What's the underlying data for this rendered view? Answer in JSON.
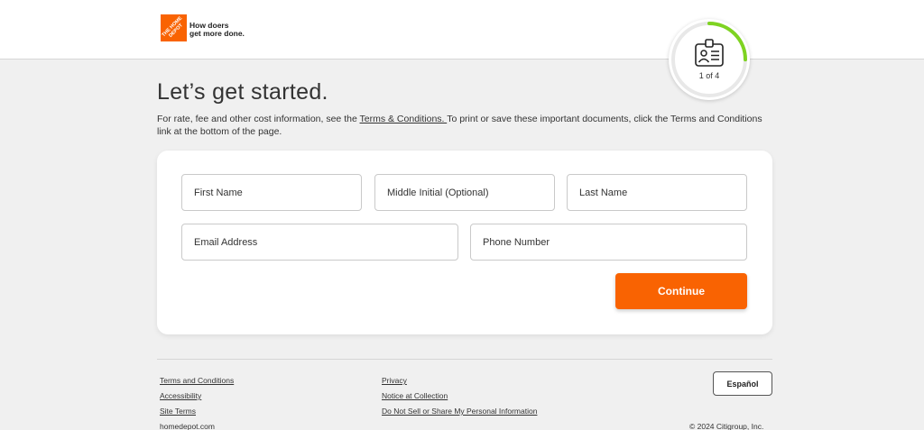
{
  "header": {
    "logo_text": "THE HOME DEPOT",
    "tagline_line1": "How doers",
    "tagline_line2": "get more done."
  },
  "progress": {
    "step_text": "1 of 4",
    "fraction": 0.25,
    "accent_color": "#7ed321"
  },
  "main": {
    "title": "Let’s get started.",
    "intro_before": "For rate, fee and other cost information, see the ",
    "intro_link": "Terms & Conditions. ",
    "intro_after": "To print or save these important documents, click the Terms and Conditions link at the bottom of the page."
  },
  "form": {
    "first_name_placeholder": "First Name",
    "middle_initial_placeholder": "Middle Initial (Optional)",
    "last_name_placeholder": "Last Name",
    "email_placeholder": "Email Address",
    "phone_placeholder": "Phone Number",
    "continue_label": "Continue"
  },
  "footer": {
    "col1": [
      "Terms and Conditions",
      "Accessibility",
      "Site Terms",
      "homedepot.com"
    ],
    "col2": [
      "Privacy",
      "Notice at Collection",
      "Do Not Sell or Share My Personal Information"
    ],
    "language_button": "Español",
    "copyright": "© 2024 Citigroup, Inc."
  },
  "colors": {
    "brand_orange": "#f96302",
    "background": "#f0f0f0"
  }
}
